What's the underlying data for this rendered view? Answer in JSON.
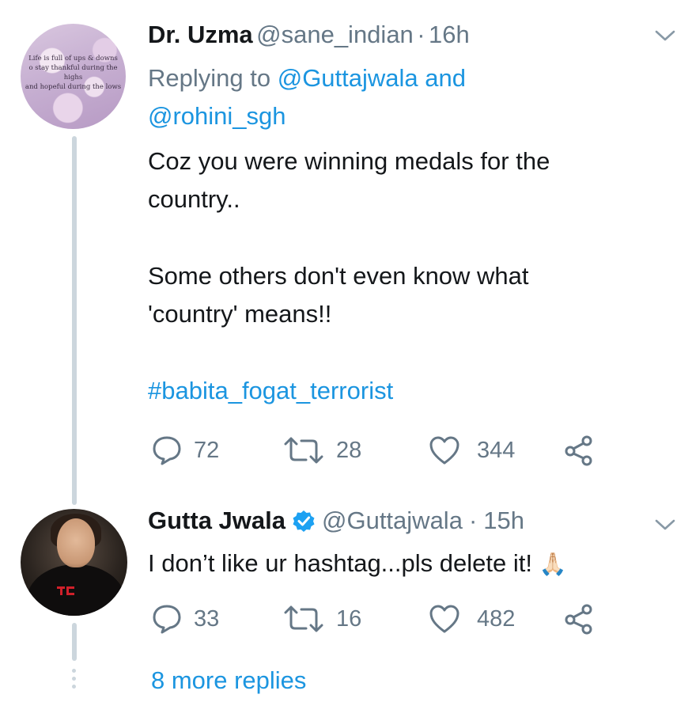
{
  "tweets": [
    {
      "display_name": "Dr. Uzma",
      "handle": "@sane_indian",
      "separator": "·",
      "time": "16h",
      "replying_prefix": "Replying to",
      "replying_user1": "@Guttajwala",
      "replying_and": "and",
      "replying_user2": "@rohini_sgh",
      "lines": [
        "Coz you were winning medals for the",
        "country..",
        "Some others don't even know what",
        "'country' means!!"
      ],
      "hashtag": "#babita_fogat_terrorist",
      "avatar_text": [
        "Life is full of ups & downs",
        "o stay thankful during the highs",
        "and hopeful during the lows"
      ],
      "replies": "72",
      "retweets": "28",
      "likes": "344"
    },
    {
      "display_name": "Gutta Jwala",
      "handle": "@Guttajwala",
      "separator": "·",
      "time": "15h",
      "text": "I don’t like ur hashtag...pls delete it!",
      "emoji": "🙏🏻",
      "replies": "33",
      "retweets": "16",
      "likes": "482"
    }
  ],
  "more_replies": "8 more replies",
  "icons": {
    "reply": "reply-icon",
    "retweet": "retweet-icon",
    "like": "heart-icon",
    "share": "share-icon",
    "menu": "chevron-down-icon",
    "verified": "verified-badge-icon"
  },
  "colors": {
    "link": "#1b95e0",
    "secondary": "#657786",
    "thread": "#ccd6dd",
    "verified": "#1da1f2"
  }
}
